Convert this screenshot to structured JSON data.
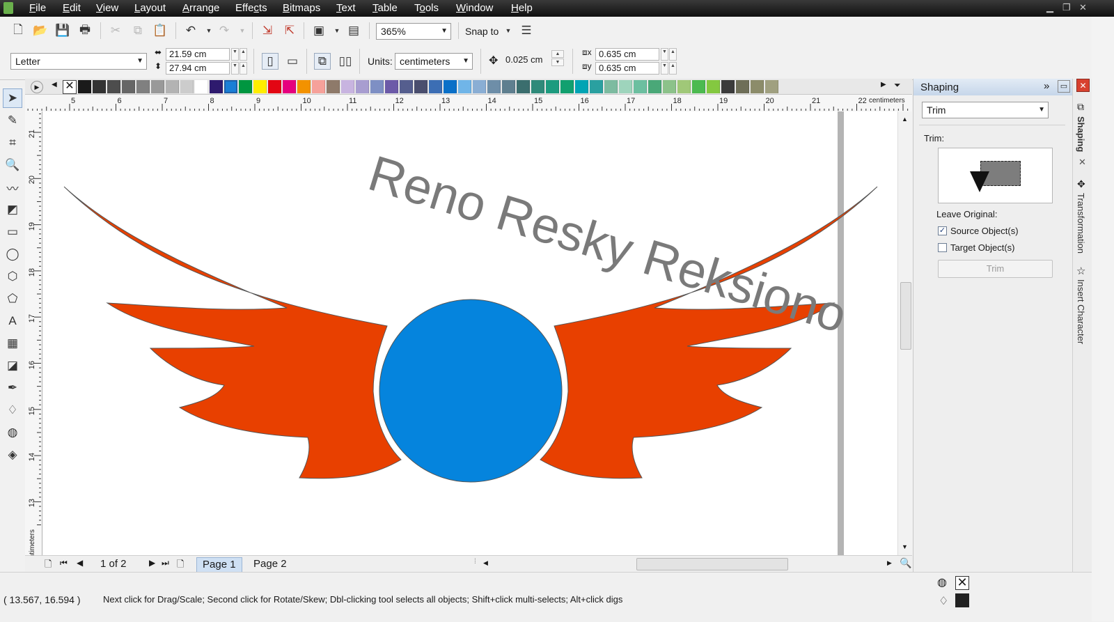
{
  "menu": [
    "File",
    "Edit",
    "View",
    "Layout",
    "Arrange",
    "Effects",
    "Bitmaps",
    "Text",
    "Table",
    "Tools",
    "Window",
    "Help"
  ],
  "toolbar": {
    "zoom": "365%",
    "snap_to": "Snap to"
  },
  "property_bar": {
    "page_size": "Letter",
    "width": "21.59 cm",
    "height": "27.94 cm",
    "units_label": "Units:",
    "units": "centimeters",
    "nudge": "0.025 cm",
    "dup_x": "0.635 cm",
    "dup_y": "0.635 cm"
  },
  "colors": {
    "wing": "#E84000",
    "circle": "#0584DD",
    "title_text": "#7a7a7a",
    "highlight": "#1a7fd6"
  },
  "palette": [
    "#1a1a1a",
    "#333333",
    "#4d4d4d",
    "#666666",
    "#808080",
    "#999999",
    "#b3b3b3",
    "#cccccc",
    "#ffffff",
    "#2e1a6e",
    "#1a7fd6",
    "#009640",
    "#ffed00",
    "#e30613",
    "#e6007e",
    "#f39200",
    "#f6a19a",
    "#8e7a6a",
    "#c8b4e0",
    "#a89dd0",
    "#7e8fc4",
    "#6c5aa8",
    "#555e8e",
    "#4a4e6e",
    "#3c6eb4",
    "#0a70c8",
    "#70b5e8",
    "#8aaed4",
    "#6e8ea8",
    "#5f7f8f",
    "#3b6e6e",
    "#2f8a7a",
    "#1d9b7f",
    "#11a06f",
    "#00a4b4",
    "#2aa0a0",
    "#7dbba0",
    "#9ed4bc",
    "#6cbfa0",
    "#4aa878",
    "#8cc28a",
    "#a0c878",
    "#4cba50",
    "#84c840",
    "#3b3b3b",
    "#6e6e58",
    "#8c8c6a",
    "#a0a080"
  ],
  "hruler": {
    "ticks": [
      "5",
      "6",
      "7",
      "8",
      "9",
      "10",
      "11",
      "12",
      "13",
      "14",
      "15",
      "16",
      "17",
      "18",
      "19",
      "20",
      "21",
      "22"
    ],
    "unit": "centimeters"
  },
  "vruler": {
    "ticks": [
      "21",
      "20",
      "19",
      "18",
      "17",
      "16",
      "15",
      "14",
      "13"
    ],
    "unit": "centimeters"
  },
  "canvas": {
    "title": "Reno Resky Reksiono"
  },
  "pages": {
    "counter": "1 of 2",
    "tabs": [
      "Page 1",
      "Page 2"
    ]
  },
  "status": {
    "coords": "( 13.567, 16.594 )",
    "hint": "Next click for Drag/Scale; Second click for Rotate/Skew; Dbl-clicking tool selects all objects; Shift+click multi-selects; Alt+click digs"
  },
  "docker": {
    "title": "Shaping",
    "mode": "Trim",
    "section_label": "Trim:",
    "leave_original": "Leave Original:",
    "source_label": "Source Object(s)",
    "source_checked": true,
    "target_label": "Target Object(s)",
    "target_checked": false,
    "apply_button": "Trim"
  },
  "docker_tabs": [
    "Shaping",
    "Transformation",
    "Insert Character"
  ]
}
